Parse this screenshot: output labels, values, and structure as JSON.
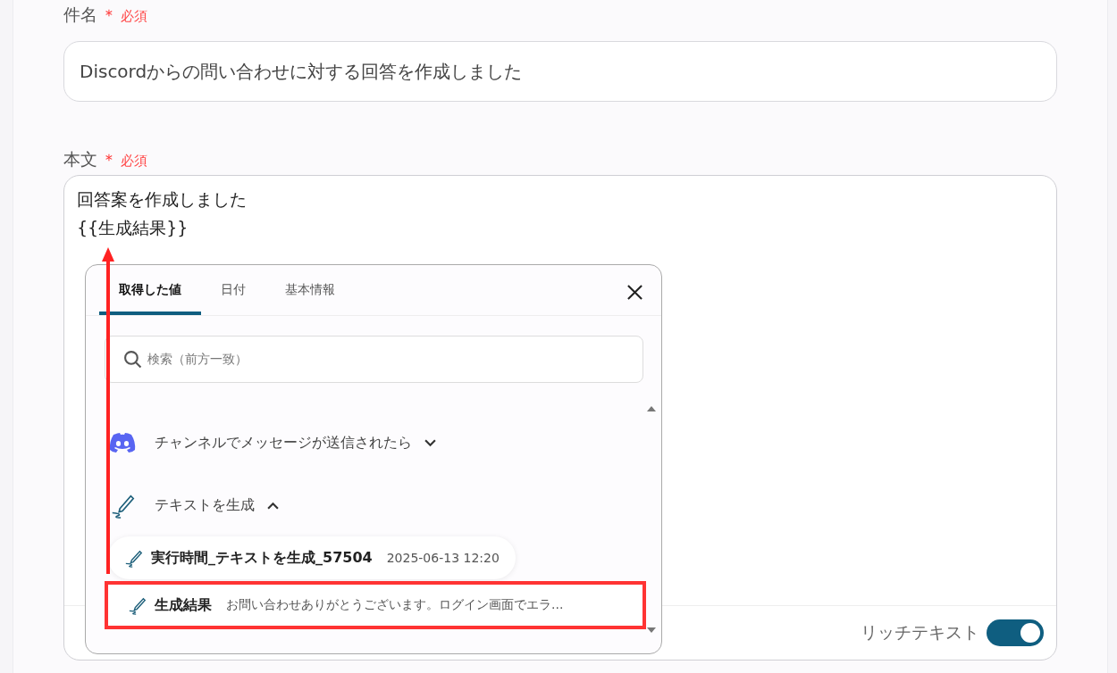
{
  "subject": {
    "label": "件名",
    "required_mark": "＊",
    "required_text": "必須",
    "value": "Discordからの問い合わせに対する回答を作成しました"
  },
  "body": {
    "label": "本文",
    "required_mark": "＊",
    "required_text": "必須",
    "lines": [
      "回答案を作成しました",
      "{{生成結果}}"
    ],
    "rich_text": {
      "label": "リッチテキスト",
      "on": true
    }
  },
  "picker": {
    "tabs": [
      {
        "label": "取得した値",
        "selected": true
      },
      {
        "label": "日付",
        "selected": false
      },
      {
        "label": "基本情報",
        "selected": false
      }
    ],
    "search": {
      "placeholder": "検索（前方一致）"
    },
    "groups": [
      {
        "kind": "discord",
        "label": "チャンネルでメッセージが送信されたら",
        "expanded": false
      },
      {
        "kind": "ai",
        "label": "テキストを生成",
        "expanded": true,
        "children": [
          {
            "name": "実行時間_テキストを生成_57504",
            "value": "2025-06-13 12:20",
            "highlighted": false
          },
          {
            "name": "生成結果",
            "value": "お問い合わせありがとうございます。ログイン画面でエラ...",
            "highlighted": true
          }
        ]
      }
    ]
  }
}
